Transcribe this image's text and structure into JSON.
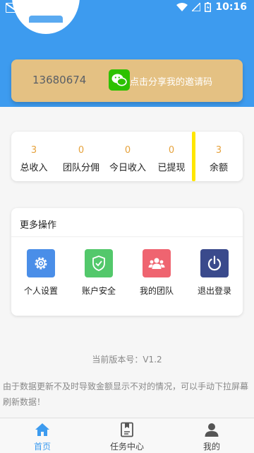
{
  "status_bar": {
    "time": "10:16"
  },
  "invite": {
    "phone": "13680674",
    "share_label": "点击分享我的邀请码"
  },
  "stats": [
    {
      "value": "3",
      "label": "总收入"
    },
    {
      "value": "0",
      "label": "团队分佣"
    },
    {
      "value": "0",
      "label": "今日收入"
    },
    {
      "value": "0",
      "label": "已提现"
    },
    {
      "value": "3",
      "label": "余额"
    }
  ],
  "more_ops": {
    "title": "更多操作",
    "items": [
      {
        "label": "个人设置",
        "icon": "gear-icon",
        "color": "#4a8ee8"
      },
      {
        "label": "账户安全",
        "icon": "shield-icon",
        "color": "#53c86b"
      },
      {
        "label": "我的团队",
        "icon": "team-icon",
        "color": "#ef6470"
      },
      {
        "label": "退出登录",
        "icon": "power-icon",
        "color": "#3a4a8c"
      }
    ]
  },
  "version_text": "当前版本号：V1.2",
  "notice_text": "由于数据更新不及时导致金额显示不对的情况，可以手动下拉屏幕刷新数据！",
  "tabs": [
    {
      "label": "首页",
      "icon": "home-icon",
      "active": true
    },
    {
      "label": "任务中心",
      "icon": "task-icon",
      "active": false
    },
    {
      "label": "我的",
      "icon": "user-icon",
      "active": false
    }
  ],
  "colors": {
    "primary": "#3d9bef",
    "gold": "#e4c183",
    "amount": "#e6a23c",
    "divider": "#ffe600"
  }
}
